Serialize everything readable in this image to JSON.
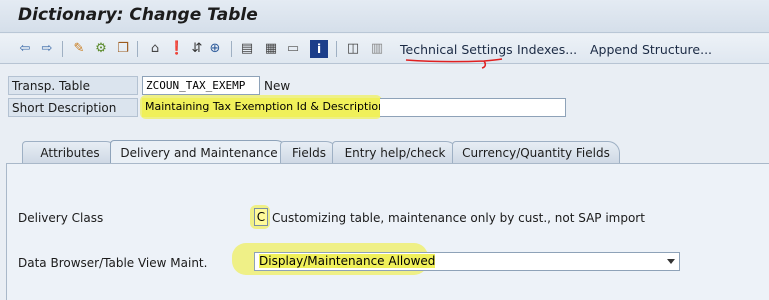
{
  "window": {
    "title": "Dictionary: Change Table"
  },
  "toolbar": {
    "icons": [
      "back-arrow-icon",
      "forward-arrow-icon",
      "edit-pencil-icon",
      "display-change-icon",
      "other-object-icon",
      "hierarchy-icon",
      "where-used-icon",
      "navigate-icon",
      "object-list-icon",
      "window-icon",
      "table-icon",
      "info-icon",
      "layout-icon",
      "grid-icon"
    ],
    "technical_settings": "Technical Settings",
    "indexes": "Indexes...",
    "append_structure": "Append Structure..."
  },
  "header": {
    "transp_table_label": "Transp. Table",
    "transp_table_value": "ZCOUN_TAX_EXEMP",
    "status": "New",
    "short_desc_label": "Short Description",
    "short_desc_value": "Maintaining Tax Exemption Id & Description"
  },
  "tabs": [
    {
      "label": "Attributes"
    },
    {
      "label": "Delivery and Maintenance"
    },
    {
      "label": "Fields"
    },
    {
      "label": "Entry help/check"
    },
    {
      "label": "Currency/Quantity Fields"
    }
  ],
  "delivery": {
    "class_label": "Delivery Class",
    "class_value": "C",
    "class_desc": "Customizing table, maintenance only by cust., not SAP import",
    "browser_label": "Data Browser/Table View Maint.",
    "browser_value": "Display/Maintenance Allowed"
  },
  "colors": {
    "highlight": "#eef07a",
    "annotation": "#e02020"
  }
}
